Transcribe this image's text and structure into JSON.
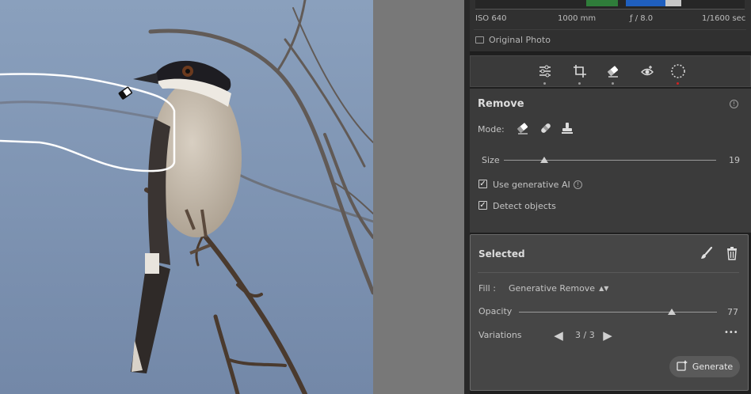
{
  "histogram": {
    "iso": "ISO 640",
    "focal": "1000 mm",
    "aperture": "ƒ / 8.0",
    "shutter": "1/1600 sec",
    "original_photo_label": "Original Photo",
    "colors": [
      "#2f7d3a",
      "#4a8bd6",
      "#1f5fbf",
      "#c7c7c7"
    ]
  },
  "toolstrip": {
    "tools": [
      "edit-sliders-icon",
      "crop-icon",
      "eraser-icon",
      "red-eye-icon",
      "masking-icon"
    ]
  },
  "remove": {
    "title": "Remove",
    "mode_label": "Mode:",
    "size_label": "Size",
    "size_value": "19",
    "size_level": 0.19,
    "use_gen_ai_label": "Use generative AI",
    "use_gen_ai_checked": true,
    "detect_objects_label": "Detect objects",
    "detect_objects_checked": true
  },
  "selected": {
    "title": "Selected",
    "fill_label": "Fill :",
    "fill_value": "Generative Remove",
    "opacity_label": "Opacity",
    "opacity_value": "77",
    "opacity_level": 0.77,
    "variations_label": "Variations",
    "variations_value": "3 / 3",
    "more_label": "•••",
    "generate_label": "Generate"
  },
  "colors": {
    "sky": "#7b93b3",
    "accent_red": "#d42020"
  }
}
